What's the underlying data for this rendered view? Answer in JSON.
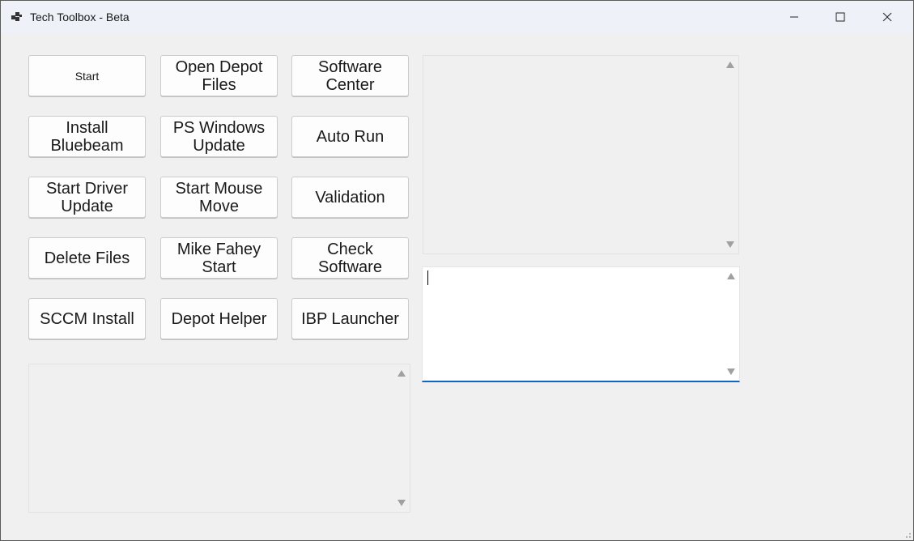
{
  "window": {
    "title": "Tech Toolbox - Beta",
    "accent": "#1464c8"
  },
  "icons": {
    "app": "app-window-icon",
    "minimize": "minimize-icon",
    "maximize": "maximize-icon",
    "close": "close-icon"
  },
  "buttons": [
    {
      "label": "Start"
    },
    {
      "label": "Open Depot\nFiles"
    },
    {
      "label": "Software\nCenter"
    },
    {
      "label": "Install\nBluebeam"
    },
    {
      "label": "PS Windows\nUpdate"
    },
    {
      "label": "Auto Run"
    },
    {
      "label": "Start Driver\nUpdate"
    },
    {
      "label": "Start Mouse\nMove"
    },
    {
      "label": "Validation"
    },
    {
      "label": "Delete Files"
    },
    {
      "label": "Mike Fahey\nStart"
    },
    {
      "label": "Check\nSoftware"
    },
    {
      "label": "SCCM Install"
    },
    {
      "label": "Depot Helper"
    },
    {
      "label": "IBP Launcher"
    }
  ],
  "text_areas": {
    "output_top": "",
    "input_active": "",
    "output_bottom": ""
  }
}
